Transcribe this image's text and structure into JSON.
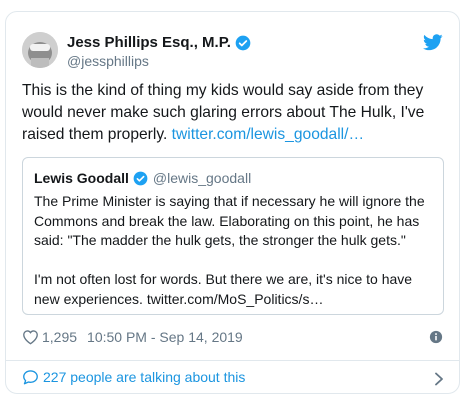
{
  "tweet": {
    "author_name": "Jess Phillips Esq., M.P.",
    "handle": "@jessphillips",
    "text": "This is the kind of thing my kids would say aside from they would never make such glaring errors about The Hulk, I've raised them properly.",
    "link_text": "twitter.com/lewis_goodall/…"
  },
  "quoted_tweet": {
    "author_name": "Lewis Goodall",
    "handle": "@lewis_goodall",
    "text": "The Prime Minister is saying that if necessary he will ignore the Commons and break the law. Elaborating on this point, he has said: \"The madder the hulk gets, the stronger the hulk gets.\"\n\nI'm not often lost for words. But there we are, it's nice to have new experiences. twitter.com/MoS_Politics/s…"
  },
  "meta": {
    "likes": "1,295",
    "timestamp": "10:50 PM - Sep 14, 2019"
  },
  "footer": {
    "talking_text": "227 people are talking about this"
  },
  "colors": {
    "link": "#1b95e0",
    "verified": "#1da1f2",
    "muted": "#657786"
  },
  "icons": [
    "verified-badge-icon",
    "twitter-logo-icon",
    "heart-icon",
    "info-icon",
    "speech-bubble-icon",
    "chevron-right-icon"
  ]
}
